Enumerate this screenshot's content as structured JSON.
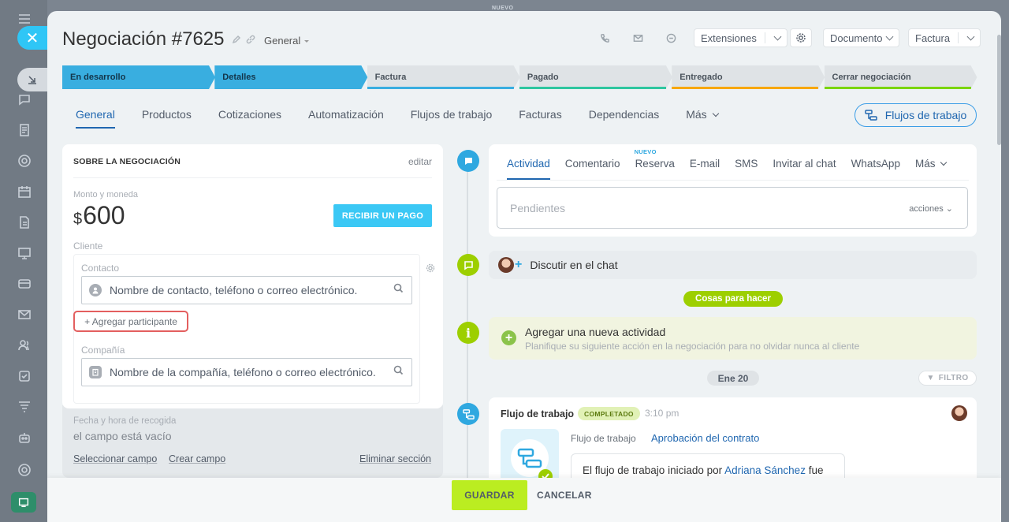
{
  "top": {
    "nuevo": "NUEVO"
  },
  "rail": {
    "icons": [
      "chat-icon",
      "document-icon",
      "target-icon",
      "calendar-icon",
      "file-icon",
      "board-icon",
      "card-icon",
      "mail-icon",
      "users-icon",
      "checkbox-icon",
      "funnel-icon",
      "robot-icon",
      "settings-icon"
    ]
  },
  "header": {
    "title": "Negociación #7625",
    "category": "General",
    "extensions": "Extensiones",
    "document": "Documento",
    "invoice": "Factura"
  },
  "stages": [
    {
      "label": "En desarrollo",
      "color": "#39aee0",
      "active": true
    },
    {
      "label": "Detalles",
      "color": "#39aee0",
      "active": true
    },
    {
      "label": "Factura",
      "color": "#39aee0",
      "active": false
    },
    {
      "label": "Pagado",
      "color": "#2fc6a0",
      "active": false
    },
    {
      "label": "Entregado",
      "color": "#f7a700",
      "active": false
    },
    {
      "label": "Cerrar negociación",
      "color": "#7bd500",
      "active": false
    }
  ],
  "tabs": [
    {
      "label": "General",
      "active": true
    },
    {
      "label": "Productos",
      "active": false
    },
    {
      "label": "Cotizaciones",
      "active": false
    },
    {
      "label": "Automatización",
      "active": false
    },
    {
      "label": "Flujos de trabajo",
      "active": false
    },
    {
      "label": "Facturas",
      "active": false
    },
    {
      "label": "Dependencias",
      "active": false
    },
    {
      "label": "Más",
      "active": false
    }
  ],
  "workflows_button": "Flujos de trabajo",
  "about": {
    "title": "SOBRE LA NEGOCIACIÓN",
    "edit": "editar",
    "amount_label": "Monto y moneda",
    "currency_symbol": "$",
    "amount": "600",
    "pay_button": "RECIBIR UN PAGO",
    "client_label": "Cliente",
    "contact_label": "Contacto",
    "contact_placeholder": "Nombre de contacto, teléfono o correo electrónico.",
    "add_participant": "+ Agregar participante",
    "company_label": "Compañía",
    "company_placeholder": "Nombre de la compañía, teléfono o correo electrónico.",
    "pickup_label": "Fecha y hora de recogida",
    "pickup_value": "el campo está vacío",
    "select_field": "Seleccionar campo",
    "create_field": "Crear campo",
    "delete_section": "Eliminar sección"
  },
  "activity": {
    "tabs": [
      "Actividad",
      "Comentario",
      "Reserva",
      "E-mail",
      "SMS",
      "Invitar al chat",
      "WhatsApp",
      "Más"
    ],
    "nuevo_badge": "NUEVO",
    "pending_placeholder": "Pendientes",
    "actions": "acciones"
  },
  "chat": {
    "label": "Discutir en el chat"
  },
  "todo": {
    "pill": "Cosas para hacer",
    "title": "Agregar una nueva actividad",
    "subtitle": "Planifique su siguiente acción en la negociación para no olvidar nunca al cliente"
  },
  "timeline": {
    "date": "Ene 20",
    "filter": "FILTRO"
  },
  "workflow": {
    "title": "Flujo de trabajo",
    "badge": "COMPLETADO",
    "time": "3:10 pm",
    "label": "Flujo de trabajo",
    "link": "Aprobación del contrato",
    "msg_prefix": "El flujo de trabajo iniciado por",
    "msg_user": "Adriana Sánchez",
    "msg_suffix": "fue"
  },
  "footer": {
    "save": "GUARDAR",
    "cancel": "CANCELAR"
  }
}
